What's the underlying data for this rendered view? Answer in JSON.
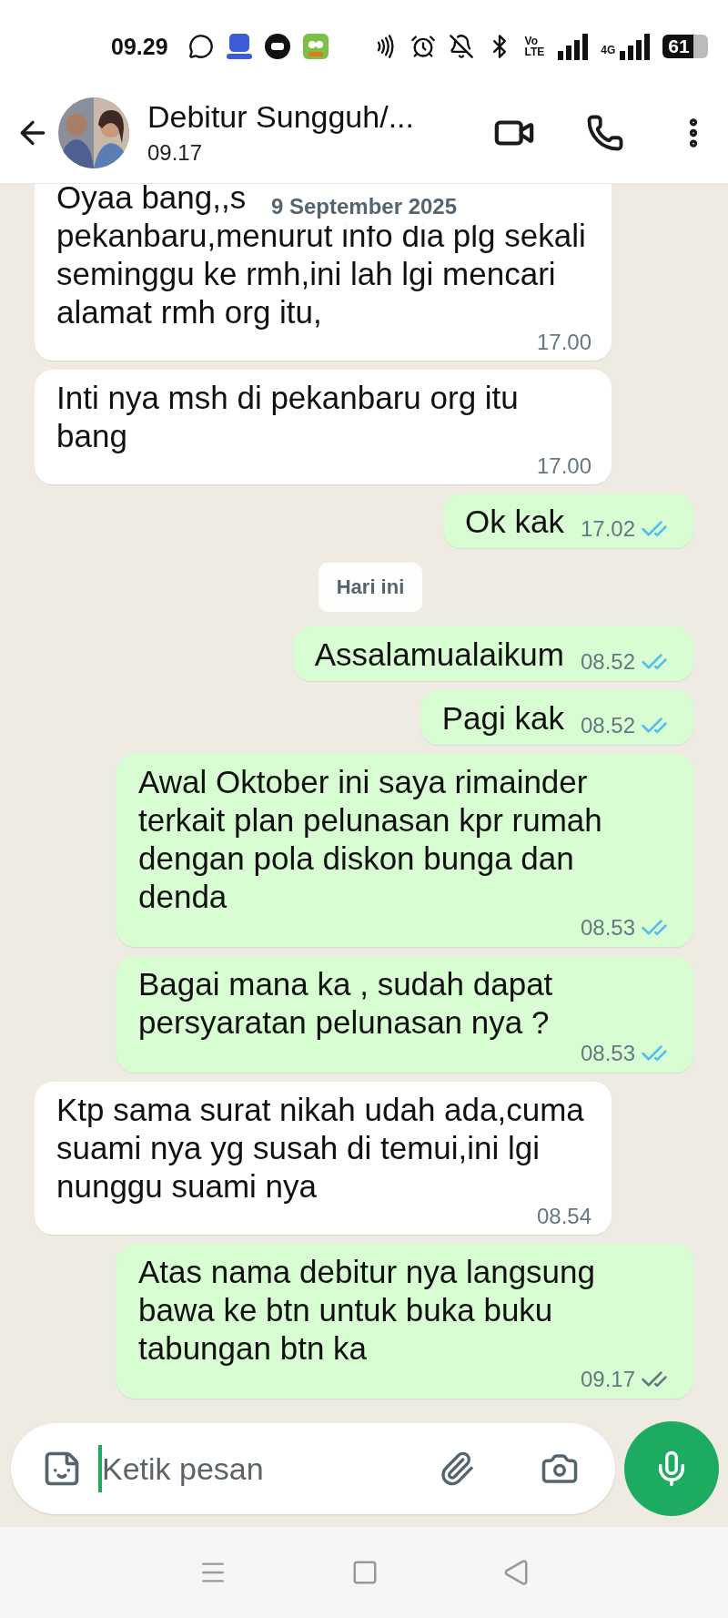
{
  "status_bar": {
    "time": "09.29",
    "volte_top": "Vo",
    "volte_bottom": "LTE",
    "network": "4G",
    "battery": "61"
  },
  "header": {
    "name": "Debitur Sungguh/...",
    "last_seen": "09.17"
  },
  "floating_date": "9 September 2025",
  "messages": [
    {
      "kind": "in_lines",
      "lines": [
        "Oyaa bang,,s",
        "pekanbaru,menurut info dia plg sekali",
        "seminggu ke rmh,ini lah lgi mencari",
        "alamat rmh org itu,"
      ],
      "time": "17.00"
    },
    {
      "kind": "in",
      "text": "Inti nya msh di pekanbaru org itu bang",
      "time": "17.00"
    },
    {
      "kind": "out",
      "text": "Ok kak",
      "time": "17.02",
      "read": true
    },
    {
      "kind": "divider",
      "text": "Hari ini"
    },
    {
      "kind": "out",
      "text": "Assalamualaikum",
      "time": "08.52",
      "read": true
    },
    {
      "kind": "out",
      "text": "Pagi kak",
      "time": "08.52",
      "read": true
    },
    {
      "kind": "out",
      "text": "Awal Oktober ini saya rimainder terkait plan pelunasan kpr rumah dengan pola diskon bunga dan denda",
      "time": "08.53",
      "read": true
    },
    {
      "kind": "out",
      "text": "Bagai mana ka , sudah dapat persyaratan pelunasan nya ?",
      "time": "08.53",
      "read": true
    },
    {
      "kind": "in",
      "text": "Ktp sama surat nikah udah ada,cuma suami nya yg susah di temui,ini lgi nunggu suami nya",
      "time": "08.54"
    },
    {
      "kind": "out",
      "text": "Atas nama debitur nya langsung bawa ke btn untuk buka buku tabungan btn ka",
      "time": "09.17",
      "read": false
    }
  ],
  "composer": {
    "placeholder": "Ketik pesan"
  }
}
